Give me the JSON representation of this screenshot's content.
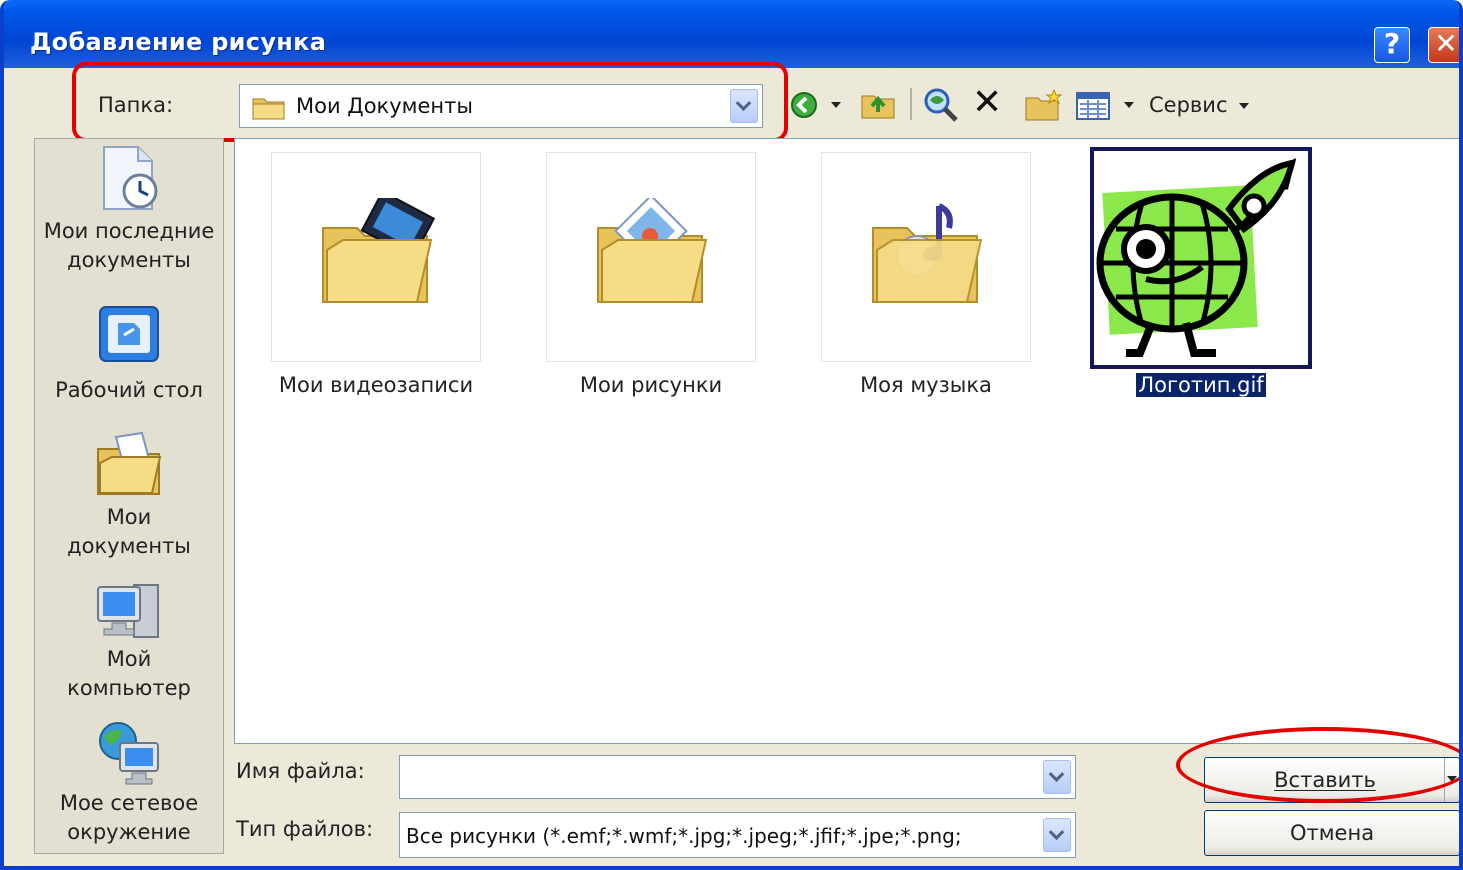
{
  "window": {
    "title": "Добавление рисунка",
    "help_glyph": "?",
    "close_glyph": "✕"
  },
  "location": {
    "label": "Папка:",
    "value": "Мои Документы"
  },
  "toolbar": {
    "service_label": "Сервис",
    "delete_glyph": "✕"
  },
  "places": [
    {
      "label_line1": "Мои последние",
      "label_line2": "документы",
      "icon": "recent-docs-icon"
    },
    {
      "label_line1": "Рабочий стол",
      "label_line2": "",
      "icon": "desktop-icon"
    },
    {
      "label_line1": "Мои",
      "label_line2": "документы",
      "icon": "my-documents-icon"
    },
    {
      "label_line1": "Мой",
      "label_line2": "компьютер",
      "icon": "my-computer-icon"
    },
    {
      "label_line1": "Мое сетевое",
      "label_line2": "окружение",
      "icon": "network-places-icon"
    }
  ],
  "files": [
    {
      "label": "Мои видеозаписи",
      "icon": "video-folder-icon"
    },
    {
      "label": "Мои рисунки",
      "icon": "pictures-folder-icon"
    },
    {
      "label": "Моя музыка",
      "icon": "music-folder-icon"
    },
    {
      "label": "Логотип.gif",
      "icon": "logo-image-thumbnail",
      "selected": true
    }
  ],
  "filename": {
    "label": "Имя файла:",
    "value": ""
  },
  "filetype": {
    "label": "Тип файлов:",
    "value": "Все рисунки (*.emf;*.wmf;*.jpg;*.jpeg;*.jfif;*.jpe;*.png;"
  },
  "buttons": {
    "insert_label": "Вставить",
    "cancel_label": "Отмена"
  },
  "colors": {
    "titlebar": "#0046d5",
    "dialog_bg": "#ece9d8",
    "highlight_annotation": "#e50000",
    "selection": "#0a246a"
  }
}
